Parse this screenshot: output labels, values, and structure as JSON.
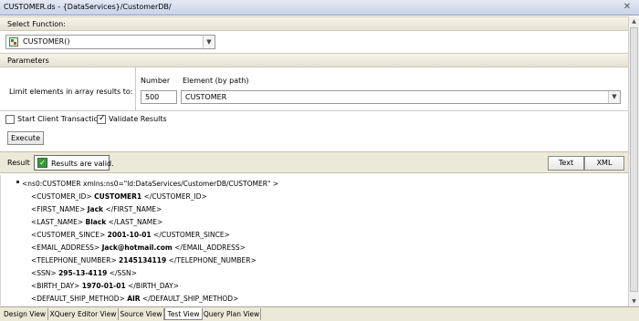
{
  "window": {
    "title": "CUSTOMER.ds - {DataServices}/CustomerDB/"
  },
  "select_function": {
    "header": "Select Function:",
    "selected": "CUSTOMER()"
  },
  "parameters": {
    "header": "Parameters",
    "limit_label": "Limit elements in array results to:",
    "number_label": "Number",
    "number_value": "500",
    "element_label": "Element (by path)",
    "element_value": "CUSTOMER"
  },
  "options": {
    "start_client_transaction": {
      "label": "Start Client Transaction",
      "checked": false
    },
    "validate_results": {
      "label": "Validate Results",
      "checked": true
    }
  },
  "execute_label": "Execute",
  "result": {
    "label": "Result",
    "status": "Results are valid.",
    "text_button": "Text",
    "xml_button": "XML"
  },
  "xml_lines": [
    {
      "open": "<ns0:CUSTOMER xmlns:ns0=\"ld:DataServices/CustomerDB/CUSTOMER\" >",
      "value": "",
      "close": ""
    },
    {
      "open": "<CUSTOMER_ID>",
      "value": "CUSTOMER1",
      "close": "</CUSTOMER_ID>"
    },
    {
      "open": "<FIRST_NAME>",
      "value": "Jack",
      "close": "</FIRST_NAME>"
    },
    {
      "open": "<LAST_NAME>",
      "value": "Black",
      "close": "</LAST_NAME>"
    },
    {
      "open": "<CUSTOMER_SINCE>",
      "value": "2001-10-01",
      "close": "</CUSTOMER_SINCE>"
    },
    {
      "open": "<EMAIL_ADDRESS>",
      "value": "Jack@hotmail.com",
      "close": "</EMAIL_ADDRESS>"
    },
    {
      "open": "<TELEPHONE_NUMBER>",
      "value": "2145134119",
      "close": "</TELEPHONE_NUMBER>"
    },
    {
      "open": "<SSN>",
      "value": "295-13-4119",
      "close": "</SSN>"
    },
    {
      "open": "<BIRTH_DAY>",
      "value": "1970-01-01",
      "close": "</BIRTH_DAY>"
    },
    {
      "open": "<DEFAULT_SHIP_METHOD>",
      "value": "AIR",
      "close": "</DEFAULT_SHIP_METHOD>"
    }
  ],
  "tabs": [
    {
      "label": "Design View",
      "active": false
    },
    {
      "label": "XQuery Editor View",
      "active": false
    },
    {
      "label": "Source View",
      "active": false
    },
    {
      "label": "Test View",
      "active": true
    },
    {
      "label": "Query Plan View",
      "active": false
    }
  ],
  "icons": {
    "function": "function-icon",
    "close": "close-icon",
    "valid": "checkmark-icon"
  }
}
